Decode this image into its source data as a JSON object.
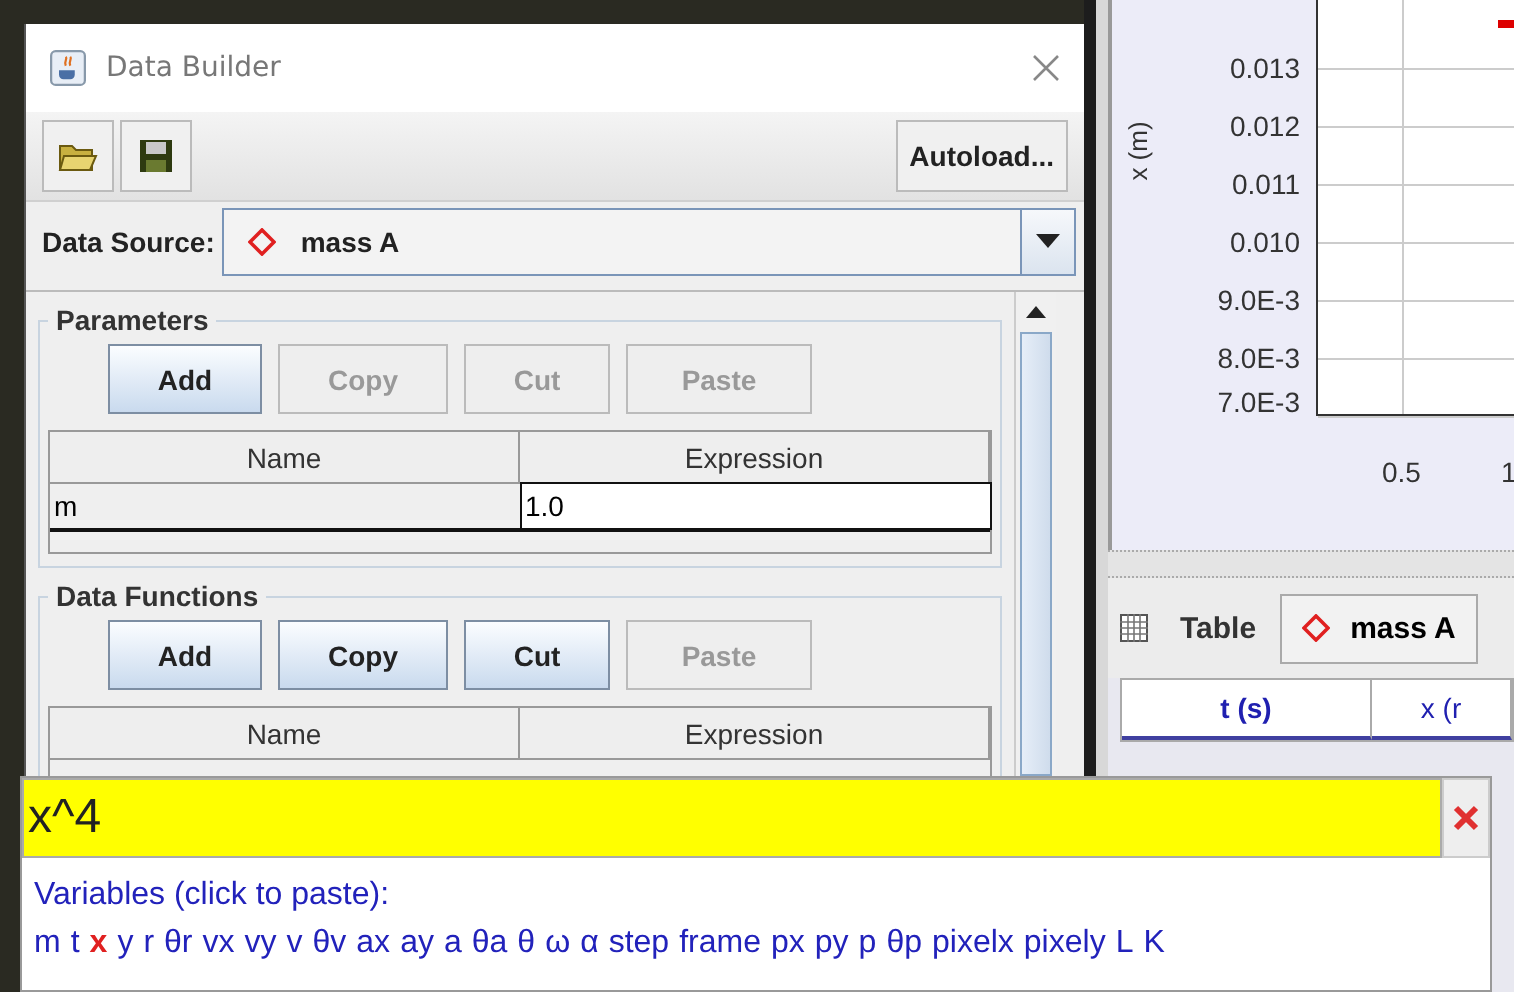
{
  "dialog": {
    "title": "Data Builder",
    "toolbar": {
      "autoload_button": "Autoload..."
    },
    "data_source": {
      "label": "Data Source:",
      "value": "mass A"
    },
    "panels": [
      {
        "title": "Parameters",
        "buttons": [
          {
            "label": "Add",
            "disabled": false
          },
          {
            "label": "Copy",
            "disabled": true
          },
          {
            "label": "Cut",
            "disabled": true
          },
          {
            "label": "Paste",
            "disabled": true
          }
        ],
        "columns": [
          "Name",
          "Expression"
        ],
        "rows": [
          {
            "name": "m",
            "expression": "1.0",
            "selected": true
          }
        ]
      },
      {
        "title": "Data Functions",
        "buttons": [
          {
            "label": "Add",
            "disabled": false
          },
          {
            "label": "Copy",
            "disabled": false
          },
          {
            "label": "Cut",
            "disabled": false
          },
          {
            "label": "Paste",
            "disabled": true
          }
        ],
        "columns": [
          "Name",
          "Expression"
        ]
      }
    ]
  },
  "editor": {
    "value": "x^4",
    "variables_label": "Variables (click to paste):",
    "variables": [
      {
        "name": "m",
        "highlighted": false
      },
      {
        "name": "t",
        "highlighted": false
      },
      {
        "name": "x",
        "highlighted": true
      },
      {
        "name": "y",
        "highlighted": false
      },
      {
        "name": "r",
        "highlighted": false
      },
      {
        "name": "θr",
        "highlighted": false
      },
      {
        "name": "vx",
        "highlighted": false
      },
      {
        "name": "vy",
        "highlighted": false
      },
      {
        "name": "v",
        "highlighted": false
      },
      {
        "name": "θv",
        "highlighted": false
      },
      {
        "name": "ax",
        "highlighted": false
      },
      {
        "name": "ay",
        "highlighted": false
      },
      {
        "name": "a",
        "highlighted": false
      },
      {
        "name": "θa",
        "highlighted": false
      },
      {
        "name": "θ",
        "highlighted": false
      },
      {
        "name": "ω",
        "highlighted": false
      },
      {
        "name": "α",
        "highlighted": false
      },
      {
        "name": "step",
        "highlighted": false
      },
      {
        "name": "frame",
        "highlighted": false
      },
      {
        "name": "px",
        "highlighted": false
      },
      {
        "name": "py",
        "highlighted": false
      },
      {
        "name": "p",
        "highlighted": false
      },
      {
        "name": "θp",
        "highlighted": false
      },
      {
        "name": "pixelx",
        "highlighted": false
      },
      {
        "name": "pixely",
        "highlighted": false
      },
      {
        "name": "L",
        "highlighted": false
      },
      {
        "name": "K",
        "highlighted": false
      }
    ]
  },
  "plot": {
    "ylabel": "x (m)",
    "yticks": [
      "0.013",
      "0.012",
      "0.011",
      "0.010",
      "9.0E-3",
      "8.0E-3",
      "7.0E-3"
    ],
    "xticks": [
      "0.5",
      "1"
    ]
  },
  "table_view": {
    "tab": "Table",
    "source": "mass A",
    "columns": [
      "t (s)",
      "x (r"
    ]
  }
}
